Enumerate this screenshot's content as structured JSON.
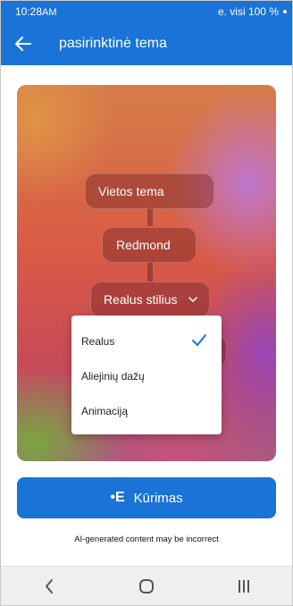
{
  "status_bar": {
    "time": "10:28",
    "am_pm": "AM",
    "network": "e. visi 100 %"
  },
  "app_bar": {
    "title": "pasirinktinė tema",
    "back_icon": "arrow-left-icon"
  },
  "theme_flow": {
    "nodes": [
      "Vietos tema",
      "Redmond",
      "Realus stilius"
    ]
  },
  "style_dropdown": {
    "options": [
      {
        "label": "Realus",
        "selected": true
      },
      {
        "label": "Aliejinių dažų",
        "selected": false
      },
      {
        "label": "Animaciją",
        "selected": false
      }
    ]
  },
  "create_button": {
    "icon_text": "•E",
    "label": "Kūrimas"
  },
  "disclaimer": "AI-generated content may be incorrect",
  "colors": {
    "primary": "#1a73d6",
    "nav_bg": "#efefef"
  },
  "nav": {
    "back_icon": "chevron-left-icon",
    "home_icon": "home-circle-icon",
    "recents_icon": "recents-bars-icon"
  }
}
